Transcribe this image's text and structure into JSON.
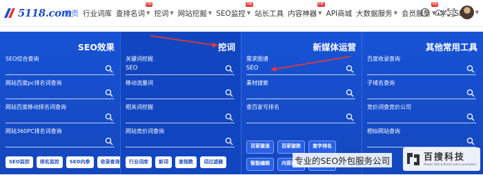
{
  "nav": {
    "logo_text": "5118.com",
    "items": [
      {
        "label": "首页",
        "active": true,
        "caret": false,
        "badge": ""
      },
      {
        "label": "行业词库",
        "caret": false,
        "badge": ""
      },
      {
        "label": "查排名词",
        "caret": true,
        "badge": "H新"
      },
      {
        "label": "挖词",
        "caret": true,
        "badge": ""
      },
      {
        "label": "网站挖掘",
        "caret": true,
        "badge": ""
      },
      {
        "label": "SEO监控",
        "caret": true,
        "badge": "H新"
      },
      {
        "label": "站长工具",
        "caret": false,
        "badge": ""
      },
      {
        "label": "内容神器",
        "caret": true,
        "badge": "H新"
      },
      {
        "label": "API商城",
        "caret": false,
        "badge": ""
      },
      {
        "label": "大数据服务",
        "caret": true,
        "badge": ""
      },
      {
        "label": "会员服务",
        "caret": true,
        "badge": "H新"
      },
      {
        "label": "学习SEO",
        "caret": true,
        "badge": ""
      }
    ],
    "caret_char": "▼",
    "icons": [
      "help-icon",
      "cloud-icon",
      "fullscreen-icon"
    ]
  },
  "columns": [
    {
      "title": "SEO效果",
      "fields": [
        {
          "label": "SEO综合查询",
          "value": ""
        },
        {
          "label": "网站百度pc排名词查询",
          "value": ""
        },
        {
          "label": "网站百度移动排名词查询",
          "value": ""
        },
        {
          "label": "网站360PC排名词查询",
          "value": ""
        }
      ],
      "buttons": [
        "SEO监控",
        "排名监控",
        "SEO内参",
        "收录查询"
      ]
    },
    {
      "title": "挖词",
      "fields": [
        {
          "label": "关键词挖掘",
          "value": "SEO"
        },
        {
          "label": "移动流量词",
          "value": ""
        },
        {
          "label": "相关词挖掘",
          "value": ""
        },
        {
          "label": "网站竞价词查询",
          "value": ""
        }
      ],
      "buttons": [
        "行业词库",
        "新词",
        "查指数",
        "词过滤器"
      ]
    },
    {
      "title": "新媒体运营",
      "fields": [
        {
          "label": "需求图谱",
          "value": "SEO"
        },
        {
          "label": "素材搜索",
          "value": ""
        },
        {
          "label": "查百家号排名",
          "value": ""
        }
      ],
      "buttons": [
        "百家骏涨",
        "百家骏跌",
        "查字排名",
        "智能编辑",
        "内容监控",
        "内容创作"
      ]
    },
    {
      "title": "其他常用工具",
      "fields": [
        {
          "label": "百度收录查询",
          "value": ""
        },
        {
          "label": "子域名查询",
          "value": ""
        },
        {
          "label": "竞价词查竞价公司",
          "value": ""
        },
        {
          "label": "相似网站查询",
          "value": ""
        }
      ],
      "buttons": []
    }
  ],
  "watermark": {
    "text": "专业的SEO外包服务公司",
    "brand_cn": "百搜科技",
    "brand_en": "Master SEO & Brand online promotion"
  },
  "colors": {
    "panel_bg": "#1753d6",
    "accent": "#2a62e0",
    "arrow": "#e53935"
  }
}
